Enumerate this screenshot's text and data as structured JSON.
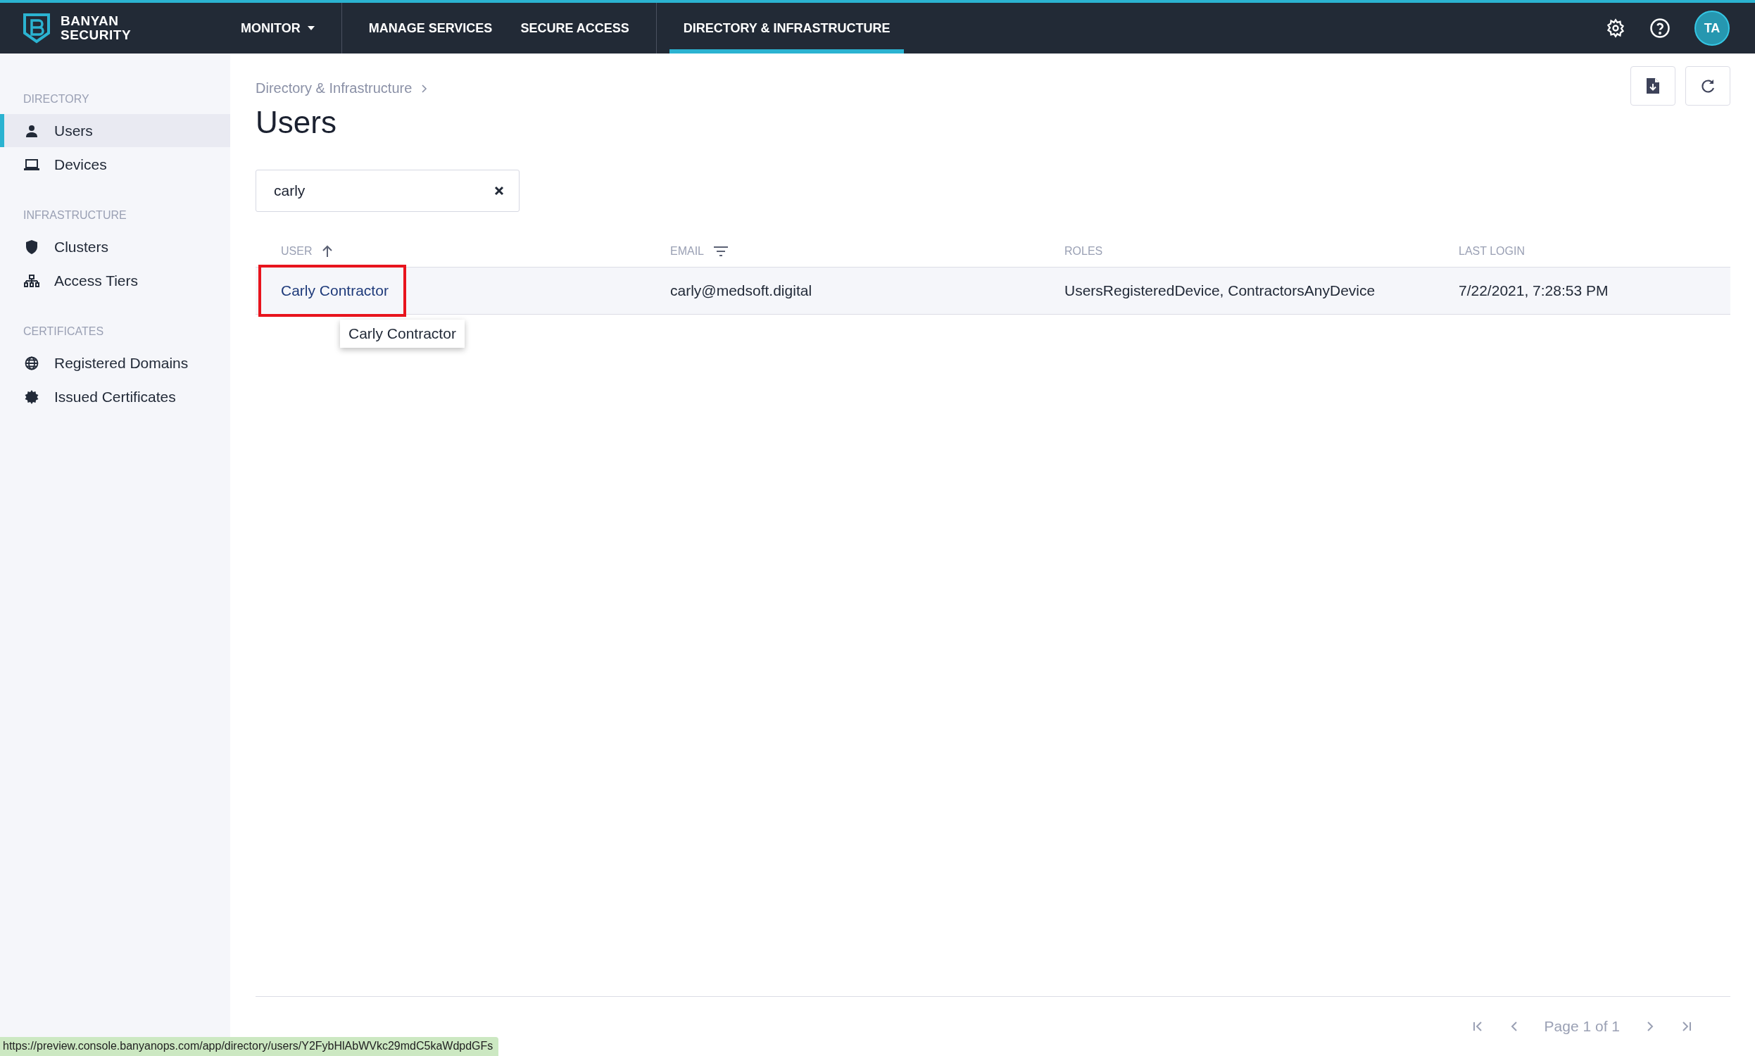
{
  "brand": {
    "line1": "BANYAN",
    "line2": "SECURITY"
  },
  "nav": [
    {
      "label": "MONITOR",
      "dropdown": true,
      "selected": false
    },
    {
      "label": "MANAGE SERVICES",
      "dropdown": false,
      "selected": false
    },
    {
      "label": "SECURE ACCESS",
      "dropdown": false,
      "selected": false
    },
    {
      "label": "DIRECTORY & INFRASTRUCTURE",
      "dropdown": false,
      "selected": true
    }
  ],
  "avatar": "TA",
  "sidebar": [
    {
      "heading": "DIRECTORY",
      "items": [
        {
          "label": "Users",
          "kind": "person",
          "selected": true
        },
        {
          "label": "Devices",
          "kind": "laptop",
          "selected": false
        }
      ]
    },
    {
      "heading": "INFRASTRUCTURE",
      "items": [
        {
          "label": "Clusters",
          "kind": "shield",
          "selected": false
        },
        {
          "label": "Access Tiers",
          "kind": "network",
          "selected": false
        }
      ]
    },
    {
      "heading": "CERTIFICATES",
      "items": [
        {
          "label": "Registered Domains",
          "kind": "globe",
          "selected": false
        },
        {
          "label": "Issued Certificates",
          "kind": "seal",
          "selected": false
        }
      ]
    }
  ],
  "breadcrumb": "Directory & Infrastructure",
  "title": "Users",
  "search": {
    "value": "carly"
  },
  "table": {
    "columns": [
      {
        "label": "USER",
        "kind": "sorted"
      },
      {
        "label": "EMAIL",
        "kind": "filterable"
      },
      {
        "label": "ROLES",
        "kind": "plain"
      },
      {
        "label": "LAST LOGIN",
        "kind": "plain"
      }
    ],
    "rows": [
      {
        "cells": [
          "Carly Contractor",
          "carly@medsoft.digital",
          "UsersRegisteredDevice, ContractorsAnyDevice",
          "7/22/2021, 7:28:53 PM"
        ],
        "highlighted": true
      }
    ]
  },
  "tooltip": "Carly Contractor",
  "pagination": "Page 1 of 1",
  "status_url": "https://preview.console.banyanops.com/app/directory/users/Y2FybHlAbWVkc29mdC5kaWdpdGFs"
}
